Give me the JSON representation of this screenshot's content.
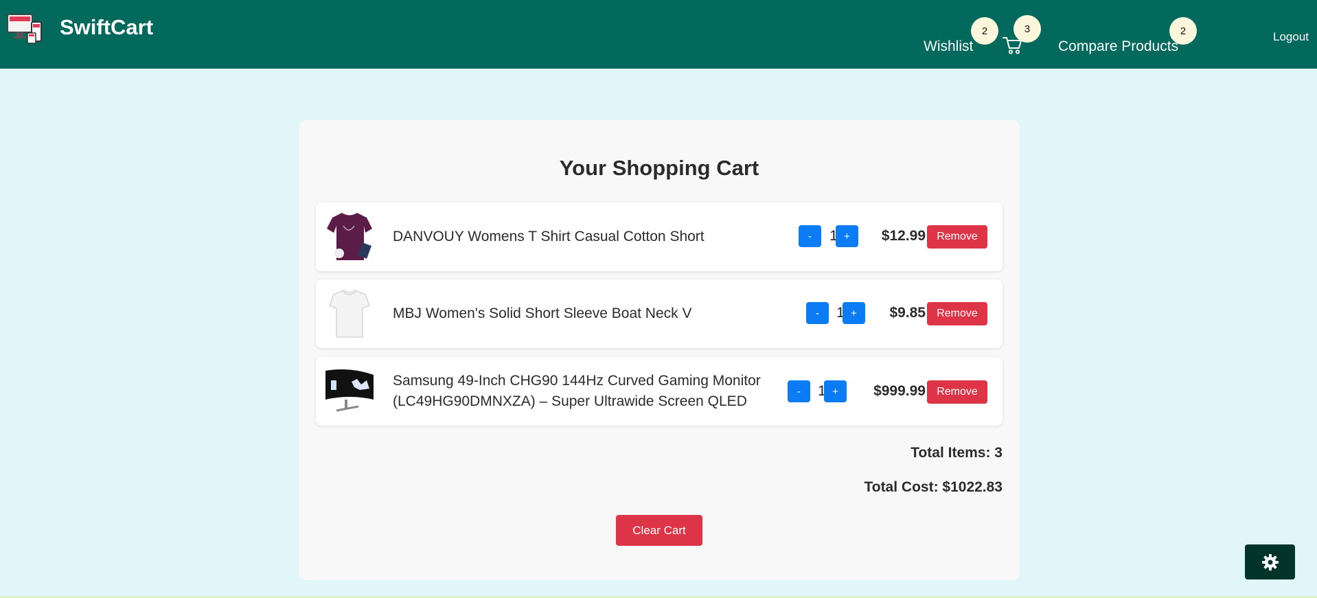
{
  "header": {
    "brand": "SwiftCart",
    "wishlist_label": "Wishlist",
    "wishlist_count": "2",
    "cart_count": "3",
    "compare_label": "Compare Products",
    "compare_count": "2",
    "logout_label": "Logout"
  },
  "cart": {
    "title": "Your Shopping Cart",
    "items": [
      {
        "name": "DANVOUY Womens T Shirt Casual Cotton Short",
        "quantity": "1",
        "price": "$12.99",
        "minus": "-",
        "plus": "+",
        "remove": "Remove"
      },
      {
        "name": "MBJ Women's Solid Short Sleeve Boat Neck V",
        "quantity": "1",
        "price": "$9.85",
        "minus": "-",
        "plus": "+",
        "remove": "Remove"
      },
      {
        "name_line1": "Samsung 49-Inch CHG90 144Hz Curved Gaming Monitor",
        "name_line2": "(LC49HG90DMNXZA) – Super Ultrawide Screen QLED",
        "quantity": "1",
        "price": "$999.99",
        "minus": "-",
        "plus": "+",
        "remove": "Remove"
      }
    ],
    "total_items": "Total Items: 3",
    "total_cost": "Total Cost: $1022.83",
    "clear_label": "Clear Cart"
  },
  "colors": {
    "header": "#02695c",
    "page_bg": "#e1f6f9",
    "qty_button": "#0c7cf4",
    "remove_button": "#dd3547",
    "badge": "#fbf6dc"
  },
  "icons": {
    "logo": "devices-logo-icon",
    "cart": "shopping-cart-icon",
    "settings": "gear-icon"
  }
}
